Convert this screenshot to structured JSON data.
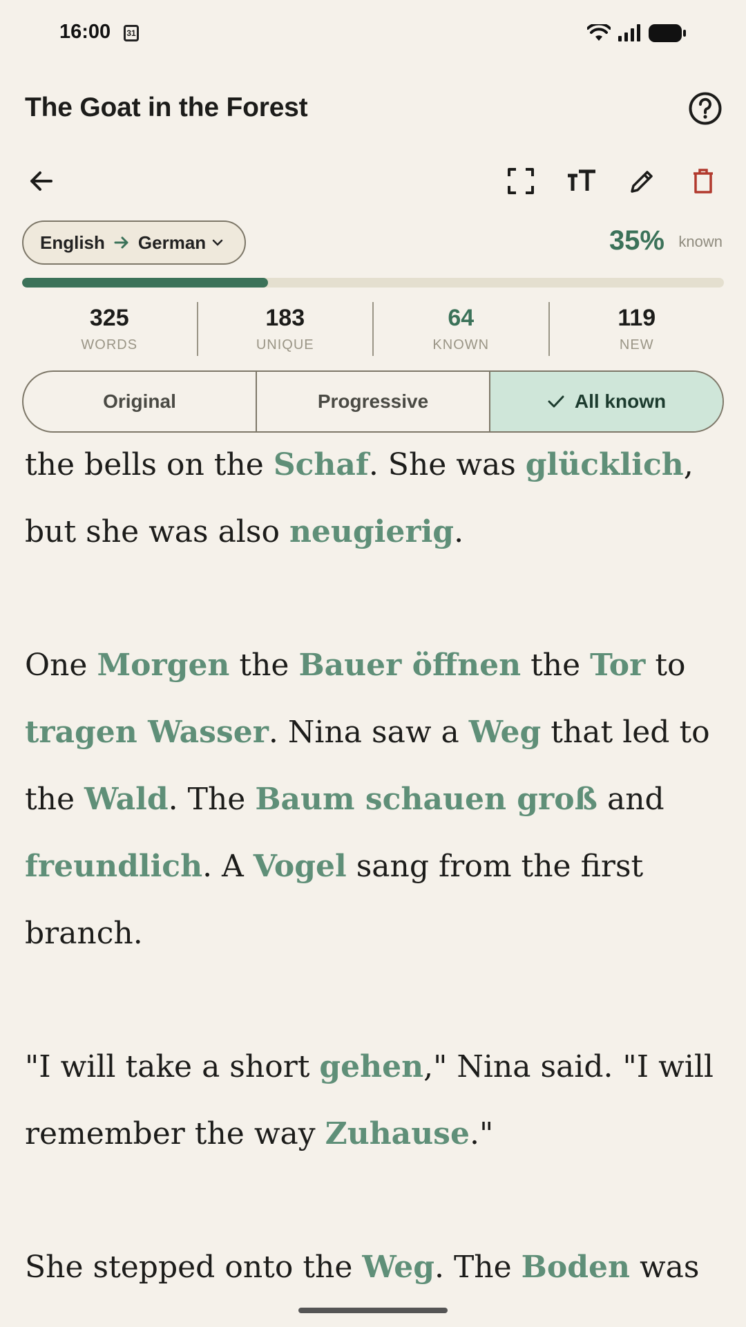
{
  "status_bar": {
    "time": "16:00",
    "calendar_day": "31"
  },
  "title": "The Goat in the Forest",
  "language": {
    "from": "English",
    "to": "German"
  },
  "known": {
    "percent_label": "35%",
    "word": "known",
    "progress": 0.35
  },
  "stats": [
    {
      "value": "325",
      "label": "WORDS"
    },
    {
      "value": "183",
      "label": "UNIQUE"
    },
    {
      "value": "64",
      "label": "KNOWN"
    },
    {
      "value": "119",
      "label": "NEW"
    }
  ],
  "modes": {
    "original": "Original",
    "progressive": "Progressive",
    "all_known": "All known",
    "selected": "all_known"
  },
  "colors": {
    "accent": "#3b7259",
    "known_word": "#5f8f78",
    "delete": "#b23a2e",
    "active_segment": "#cfe6d9",
    "background": "#f5f1ea"
  },
  "paragraphs": [
    [
      {
        "t": "the bells on the "
      },
      {
        "t": "Schaf",
        "k": true
      },
      {
        "t": ". She was "
      },
      {
        "t": "glücklich",
        "k": true
      },
      {
        "t": ", but she was also "
      },
      {
        "t": "neugierig",
        "k": true
      },
      {
        "t": "."
      }
    ],
    [
      {
        "t": "One "
      },
      {
        "t": "Morgen",
        "k": true
      },
      {
        "t": " the "
      },
      {
        "t": "Bauer öffnen",
        "k": true
      },
      {
        "t": " the "
      },
      {
        "t": "Tor",
        "k": true
      },
      {
        "t": " to "
      },
      {
        "t": "tragen Wasser",
        "k": true
      },
      {
        "t": ". Nina saw a "
      },
      {
        "t": "Weg",
        "k": true
      },
      {
        "t": " that led to the "
      },
      {
        "t": "Wald",
        "k": true
      },
      {
        "t": ". The "
      },
      {
        "t": "Baum schauen groß",
        "k": true
      },
      {
        "t": " and "
      },
      {
        "t": "freundlich",
        "k": true
      },
      {
        "t": ". A "
      },
      {
        "t": "Vogel",
        "k": true
      },
      {
        "t": " sang from the first branch."
      }
    ],
    [
      {
        "t": "\"I will take a short "
      },
      {
        "t": "gehen",
        "k": true
      },
      {
        "t": ",\" Nina said. \"I will remember the way "
      },
      {
        "t": "Zuhause",
        "k": true
      },
      {
        "t": ".\""
      }
    ],
    [
      {
        "t": "She stepped onto the "
      },
      {
        "t": "Weg",
        "k": true
      },
      {
        "t": ". The "
      },
      {
        "t": "Boden",
        "k": true
      },
      {
        "t": " was"
      }
    ]
  ]
}
